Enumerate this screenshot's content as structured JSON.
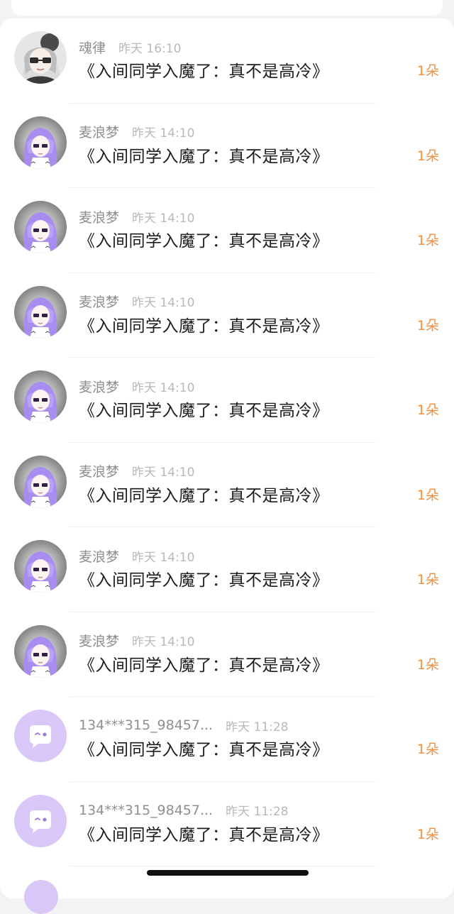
{
  "messages": [
    {
      "avatar": "goth-girl-avatar",
      "name": "魂律",
      "time": "昨天 16:10",
      "title": "《入间同学入魔了：真不是高冷》",
      "count": "1朵"
    },
    {
      "avatar": "purple-hair-anime-avatar",
      "name": "麦浪梦",
      "time": "昨天 14:10",
      "title": "《入间同学入魔了：真不是高冷》",
      "count": "1朵"
    },
    {
      "avatar": "purple-hair-anime-avatar",
      "name": "麦浪梦",
      "time": "昨天 14:10",
      "title": "《入间同学入魔了：真不是高冷》",
      "count": "1朵"
    },
    {
      "avatar": "purple-hair-anime-avatar",
      "name": "麦浪梦",
      "time": "昨天 14:10",
      "title": "《入间同学入魔了：真不是高冷》",
      "count": "1朵"
    },
    {
      "avatar": "purple-hair-anime-avatar",
      "name": "麦浪梦",
      "time": "昨天 14:10",
      "title": "《入间同学入魔了：真不是高冷》",
      "count": "1朵"
    },
    {
      "avatar": "purple-hair-anime-avatar",
      "name": "麦浪梦",
      "time": "昨天 14:10",
      "title": "《入间同学入魔了：真不是高冷》",
      "count": "1朵"
    },
    {
      "avatar": "purple-hair-anime-avatar",
      "name": "麦浪梦",
      "time": "昨天 14:10",
      "title": "《入间同学入魔了：真不是高冷》",
      "count": "1朵"
    },
    {
      "avatar": "purple-hair-anime-avatar",
      "name": "麦浪梦",
      "time": "昨天 14:10",
      "title": "《入间同学入魔了：真不是高冷》",
      "count": "1朵"
    },
    {
      "avatar": "default-chat-bubble-avatar",
      "name": "134***315_98457...",
      "time": "昨天 11:28",
      "title": "《入间同学入魔了：真不是高冷》",
      "count": "1朵"
    },
    {
      "avatar": "default-chat-bubble-avatar",
      "name": "134***315_98457...",
      "time": "昨天 11:28",
      "title": "《入间同学入魔了：真不是高冷》",
      "count": "1朵"
    }
  ],
  "colors": {
    "accent_count": "#f0913e",
    "default_avatar_bg": "#d9c7f7",
    "anime_hair": "#a98cf0"
  }
}
